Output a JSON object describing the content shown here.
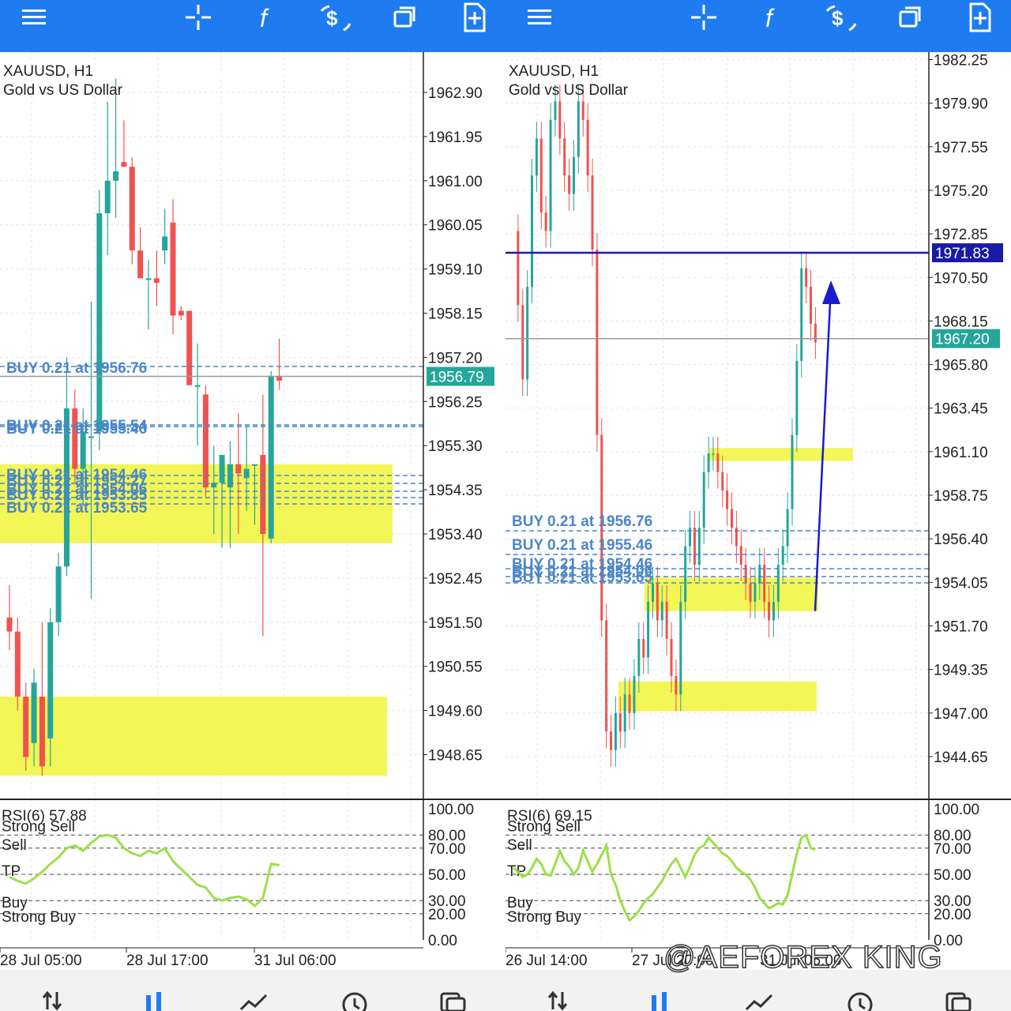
{
  "toolbar_icons": [
    "menu-icon",
    "crosshair-icon",
    "function-icon",
    "trade-dollar-icon",
    "windows-icon",
    "new-order-icon"
  ],
  "bottom_icons": [
    "quotes-icon",
    "chart-icon",
    "trade-icon",
    "history-icon",
    "messages-icon"
  ],
  "watermark": "@AEFOREX KING",
  "colors": {
    "bull": "#26a69a",
    "bear": "#ef5350",
    "zone": "#f2f545",
    "orderline": "#4a86c8",
    "rsi": "#9be04b",
    "topbar": "#1e7cf0"
  },
  "panels": [
    {
      "symbol": "XAUUSD, H1",
      "description": "Gold vs US Dollar",
      "price_axis": [
        "1962.90",
        "1961.95",
        "1961.00",
        "1960.05",
        "1959.10",
        "1958.15",
        "1957.20",
        "1956.25",
        "1955.30",
        "1954.35",
        "1953.40",
        "1952.45",
        "1951.50",
        "1950.55",
        "1949.60",
        "1948.65"
      ],
      "current_price": "1956.79",
      "orders": [
        "BUY 0.21 at 1956.76",
        "BUY 0.21 at 1955.54",
        "BUY 0.21 at 1955.46",
        "BUY 0.21 at 1954.46",
        "BUY 0.21 at 1954.27",
        "BUY 0.21 at 1954.06",
        "BUY 0.21 at 1953.85",
        "BUY 0.21 at 1953.65"
      ],
      "rsi_label": "RSI(6) 57.88",
      "rsi_axis": [
        "100.00",
        "80.00",
        "70.00",
        "50.00",
        "30.00",
        "20.00",
        "0.00"
      ],
      "rsi_levels": [
        "Strong Sell",
        "Sell",
        "TP",
        "Buy",
        "Strong Buy"
      ],
      "time_axis": [
        "28 Jul 05:00",
        "28 Jul 17:00",
        "31 Jul 06:00"
      ]
    },
    {
      "symbol": "XAUUSD, H1",
      "description": "Gold vs US Dollar",
      "price_axis": [
        "1982.25",
        "1979.90",
        "1977.55",
        "1975.20",
        "1972.85",
        "1970.50",
        "1968.15",
        "1965.80",
        "1963.45",
        "1961.10",
        "1958.75",
        "1956.40",
        "1954.05",
        "1951.70",
        "1949.35",
        "1947.00",
        "1944.65"
      ],
      "current_price": "1967.20",
      "level_price": "1971.83",
      "orders": [
        "BUY 0.21 at 1956.76",
        "BUY 0.21 at 1955.46",
        "BUY 0.21 at 1954.46",
        "BUY 0.21 at 1954.06",
        "BUY 0.21 at 1953.65"
      ],
      "rsi_label": "RSI(6) 69.15",
      "rsi_axis": [
        "100.00",
        "80.00",
        "70.00",
        "50.00",
        "30.00",
        "20.00",
        "0.00"
      ],
      "rsi_levels": [
        "Strong Sell",
        "Sell",
        "TP",
        "Buy",
        "Strong Buy"
      ],
      "time_axis": [
        "26 Jul 14:00",
        "27 Jul 20:00",
        "31 Jul 06:00"
      ]
    }
  ],
  "chart_data": [
    {
      "type": "candlestick",
      "title": "XAUUSD, H1",
      "subtitle": "Gold vs US Dollar",
      "ylim": [
        1948.2,
        1963.5
      ],
      "x": [
        "28 Jul 05:00",
        "28 Jul 17:00",
        "31 Jul 06:00"
      ],
      "candles": [
        [
          1951.6,
          1952.3,
          1950.9,
          1951.3
        ],
        [
          1951.3,
          1951.6,
          1949.6,
          1949.9
        ],
        [
          1949.9,
          1950.2,
          1948.3,
          1948.6
        ],
        [
          1948.9,
          1950.5,
          1948.4,
          1950.2
        ],
        [
          1949.9,
          1951.5,
          1948.2,
          1948.4
        ],
        [
          1949.0,
          1951.8,
          1948.4,
          1951.5
        ],
        [
          1951.5,
          1953.0,
          1951.2,
          1952.7
        ],
        [
          1952.7,
          1957.2,
          1952.5,
          1956.1
        ],
        [
          1956.1,
          1956.5,
          1954.5,
          1954.8
        ],
        [
          1954.8,
          1956.1,
          1954.0,
          1955.6
        ],
        [
          1955.5,
          1958.4,
          1952.0,
          1955.5
        ],
        [
          1955.6,
          1960.8,
          1955.2,
          1960.3
        ],
        [
          1960.3,
          1962.7,
          1959.4,
          1961.0
        ],
        [
          1961.0,
          1963.2,
          1960.2,
          1961.2
        ],
        [
          1961.4,
          1962.3,
          1961.3,
          1961.3
        ],
        [
          1961.3,
          1961.5,
          1959.2,
          1959.5
        ],
        [
          1959.5,
          1960.0,
          1958.9,
          1958.9
        ],
        [
          1958.9,
          1959.3,
          1957.8,
          1958.9
        ],
        [
          1958.9,
          1959.5,
          1958.3,
          1958.8
        ],
        [
          1959.5,
          1960.4,
          1959.2,
          1959.8
        ],
        [
          1960.1,
          1960.6,
          1957.7,
          1958.1
        ],
        [
          1958.2,
          1958.3,
          1958.0,
          1958.1
        ],
        [
          1958.2,
          1958.2,
          1956.6,
          1956.6
        ],
        [
          1956.6,
          1957.5,
          1955.3,
          1956.6
        ],
        [
          1956.4,
          1956.6,
          1954.2,
          1954.4
        ],
        [
          1954.4,
          1955.3,
          1953.4,
          1954.5
        ],
        [
          1954.5,
          1954.9,
          1953.1,
          1955.1
        ],
        [
          1954.4,
          1955.4,
          1953.1,
          1954.9
        ],
        [
          1954.9,
          1956.0,
          1953.4,
          1954.7
        ],
        [
          1954.6,
          1955.7,
          1953.9,
          1954.8
        ],
        [
          1954.9,
          1954.9,
          1953.6,
          1954.9
        ],
        [
          1955.1,
          1956.4,
          1951.2,
          1953.4
        ],
        [
          1953.3,
          1956.9,
          1953.2,
          1956.8
        ],
        [
          1956.8,
          1957.6,
          1956.5,
          1956.7
        ]
      ],
      "zones": [
        [
          1953.2,
          1954.9
        ],
        [
          1948.2,
          1949.9
        ]
      ],
      "rsi": [
        48,
        45,
        43,
        47,
        52,
        58,
        63,
        70,
        72,
        68,
        74,
        79,
        80,
        78,
        70,
        66,
        64,
        68,
        66,
        70,
        60,
        54,
        48,
        42,
        40,
        32,
        30,
        32,
        33,
        31,
        26,
        32,
        58,
        57
      ]
    },
    {
      "type": "candlestick",
      "title": "XAUUSD, H1",
      "subtitle": "Gold vs US Dollar",
      "ylim": [
        1943.0,
        1982.5
      ],
      "x": [
        "26 Jul 14:00",
        "27 Jul 20:00",
        "31 Jul 06:00"
      ],
      "levels": [
        1971.83,
        1967.2
      ],
      "arrow": {
        "from": [
          1952.5
        ],
        "to": [
          1970.9
        ]
      },
      "zones": [
        [
          1960.6,
          1961.3
        ],
        [
          1952.5,
          1954.3
        ],
        [
          1947.1,
          1948.7
        ]
      ],
      "rsi": [
        55,
        52,
        48,
        50,
        55,
        62,
        58,
        50,
        49,
        58,
        68,
        60,
        56,
        50,
        55,
        68,
        60,
        52,
        58,
        65,
        72,
        50,
        42,
        30,
        22,
        15,
        18,
        22,
        28,
        32,
        35,
        40,
        45,
        52,
        58,
        62,
        55,
        48,
        56,
        65,
        70,
        72,
        78,
        74,
        70,
        66,
        64,
        60,
        55,
        52,
        50,
        46,
        40,
        32,
        28,
        24,
        26,
        28,
        27,
        34,
        50,
        66,
        78,
        80,
        70,
        69
      ]
    }
  ]
}
